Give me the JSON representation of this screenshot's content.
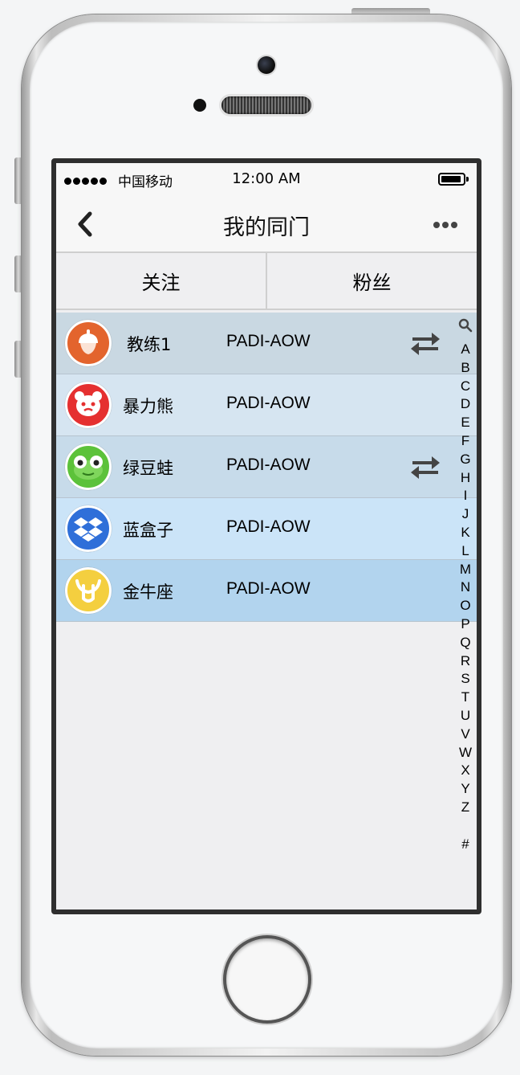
{
  "status_bar": {
    "carrier": "中国移动",
    "time": "12:00 AM"
  },
  "nav": {
    "title": "我的同门",
    "back_icon": "chevron-left-icon",
    "more_icon": "more-horizontal-icon"
  },
  "tabs": [
    {
      "label": "关注"
    },
    {
      "label": "粉丝"
    }
  ],
  "contacts": [
    {
      "name": "教练1",
      "level": "PADI-AOW",
      "avatar_icon": "acorn-avatar-icon",
      "avatar_color": "#e3642d",
      "row_color": "#c9d8e2",
      "mutual_follow": true
    },
    {
      "name": "暴力熊",
      "level": "PADI-AOW",
      "avatar_icon": "bear-avatar-icon",
      "avatar_color": "#e53030",
      "row_color": "#d6e5f1",
      "mutual_follow": false
    },
    {
      "name": "绿豆蛙",
      "level": "PADI-AOW",
      "avatar_icon": "frog-avatar-icon",
      "avatar_color": "#5cc23a",
      "row_color": "#c7dbea",
      "mutual_follow": true
    },
    {
      "name": "蓝盒子",
      "level": "PADI-AOW",
      "avatar_icon": "dropbox-avatar-icon",
      "avatar_color": "#2f6fd9",
      "row_color": "#cbe4f8",
      "mutual_follow": false
    },
    {
      "name": "金牛座",
      "level": "PADI-AOW",
      "avatar_icon": "taurus-avatar-icon",
      "avatar_color": "#f4cf3f",
      "row_color": "#b2d4ee",
      "mutual_follow": false
    }
  ],
  "index_bar": {
    "search_icon": "search-icon",
    "letters": [
      "A",
      "B",
      "C",
      "D",
      "E",
      "F",
      "G",
      "H",
      "I",
      "J",
      "K",
      "L",
      "M",
      "N",
      "O",
      "P",
      "Q",
      "R",
      "S",
      "T",
      "U",
      "V",
      "W",
      "X",
      "Y",
      "Z"
    ],
    "hash": "#"
  }
}
